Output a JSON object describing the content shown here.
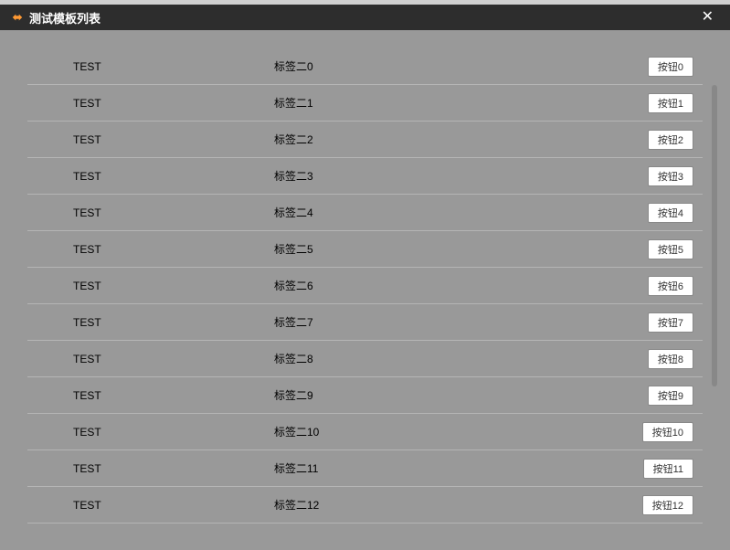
{
  "header": {
    "title": "测试模板列表"
  },
  "rows": [
    {
      "col1": "TEST",
      "col2": "标签二0",
      "button": "按钮0"
    },
    {
      "col1": "TEST",
      "col2": "标签二1",
      "button": "按钮1"
    },
    {
      "col1": "TEST",
      "col2": "标签二2",
      "button": "按钮2"
    },
    {
      "col1": "TEST",
      "col2": "标签二3",
      "button": "按钮3"
    },
    {
      "col1": "TEST",
      "col2": "标签二4",
      "button": "按钮4"
    },
    {
      "col1": "TEST",
      "col2": "标签二5",
      "button": "按钮5"
    },
    {
      "col1": "TEST",
      "col2": "标签二6",
      "button": "按钮6"
    },
    {
      "col1": "TEST",
      "col2": "标签二7",
      "button": "按钮7"
    },
    {
      "col1": "TEST",
      "col2": "标签二8",
      "button": "按钮8"
    },
    {
      "col1": "TEST",
      "col2": "标签二9",
      "button": "按钮9"
    },
    {
      "col1": "TEST",
      "col2": "标签二10",
      "button": "按钮10"
    },
    {
      "col1": "TEST",
      "col2": "标签二11",
      "button": "按钮11"
    },
    {
      "col1": "TEST",
      "col2": "标签二12",
      "button": "按钮12"
    }
  ]
}
